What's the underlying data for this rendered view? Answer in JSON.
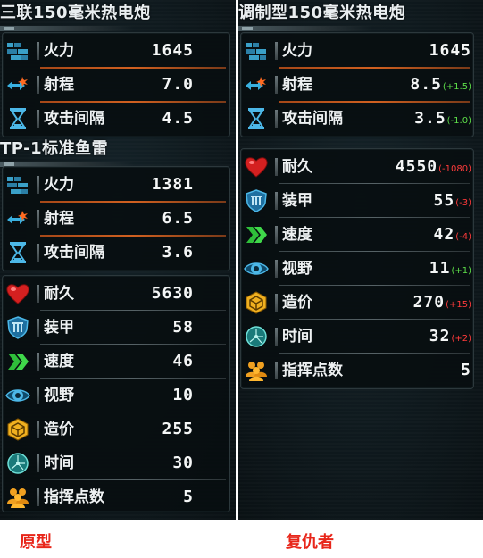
{
  "left": {
    "weapons": [
      {
        "title": "三联150毫米热电炮",
        "rows": [
          {
            "icon": "firepower-icon",
            "label": "火力",
            "value": "1645"
          },
          {
            "icon": "range-icon",
            "label": "射程",
            "value": "7.0"
          },
          {
            "icon": "hourglass-icon",
            "label": "攻击间隔",
            "value": "4.5"
          }
        ]
      },
      {
        "title": "TP-1标准鱼雷",
        "rows": [
          {
            "icon": "firepower-icon",
            "label": "火力",
            "value": "1381"
          },
          {
            "icon": "range-icon",
            "label": "射程",
            "value": "6.5"
          },
          {
            "icon": "hourglass-icon",
            "label": "攻击间隔",
            "value": "3.6"
          }
        ]
      }
    ],
    "stats": [
      {
        "icon": "heart-icon",
        "label": "耐久",
        "value": "5630"
      },
      {
        "icon": "armor-icon",
        "label": "装甲",
        "value": "58"
      },
      {
        "icon": "speed-chevron-icon",
        "label": "速度",
        "value": "46"
      },
      {
        "icon": "eye-icon",
        "label": "视野",
        "value": "10"
      },
      {
        "icon": "cost-hexagon-icon",
        "label": "造价",
        "value": "255"
      },
      {
        "icon": "clock-icon",
        "label": "时间",
        "value": "30"
      },
      {
        "icon": "command-points-icon",
        "label": "指挥点数",
        "value": "5"
      }
    ],
    "caption": "原型"
  },
  "right": {
    "weapons": [
      {
        "title": "调制型150毫米热电炮",
        "rows": [
          {
            "icon": "firepower-icon",
            "label": "火力",
            "value": "1645",
            "delta": ""
          },
          {
            "icon": "range-icon",
            "label": "射程",
            "value": "8.5",
            "delta": "(+1.5)",
            "delta_type": "pos"
          },
          {
            "icon": "hourglass-icon",
            "label": "攻击间隔",
            "value": "3.5",
            "delta": "(-1.0)",
            "delta_type": "pos"
          }
        ]
      }
    ],
    "stats": [
      {
        "icon": "heart-icon",
        "label": "耐久",
        "value": "4550",
        "delta": "(-1080)",
        "delta_type": "neg"
      },
      {
        "icon": "armor-icon",
        "label": "装甲",
        "value": "55",
        "delta": "(-3)",
        "delta_type": "neg"
      },
      {
        "icon": "speed-chevron-icon",
        "label": "速度",
        "value": "42",
        "delta": "(-4)",
        "delta_type": "neg"
      },
      {
        "icon": "eye-icon",
        "label": "视野",
        "value": "11",
        "delta": "(+1)",
        "delta_type": "pos"
      },
      {
        "icon": "cost-hexagon-icon",
        "label": "造价",
        "value": "270",
        "delta": "(+15)",
        "delta_type": "neg"
      },
      {
        "icon": "clock-icon",
        "label": "时间",
        "value": "32",
        "delta": "(+2)",
        "delta_type": "neg"
      },
      {
        "icon": "command-points-icon",
        "label": "指挥点数",
        "value": "5",
        "delta": ""
      }
    ],
    "caption": "复仇者"
  },
  "colors": {
    "positive_delta": "#5ee04a",
    "negative_delta": "#ff3b3b",
    "caption": "#e8261a"
  }
}
